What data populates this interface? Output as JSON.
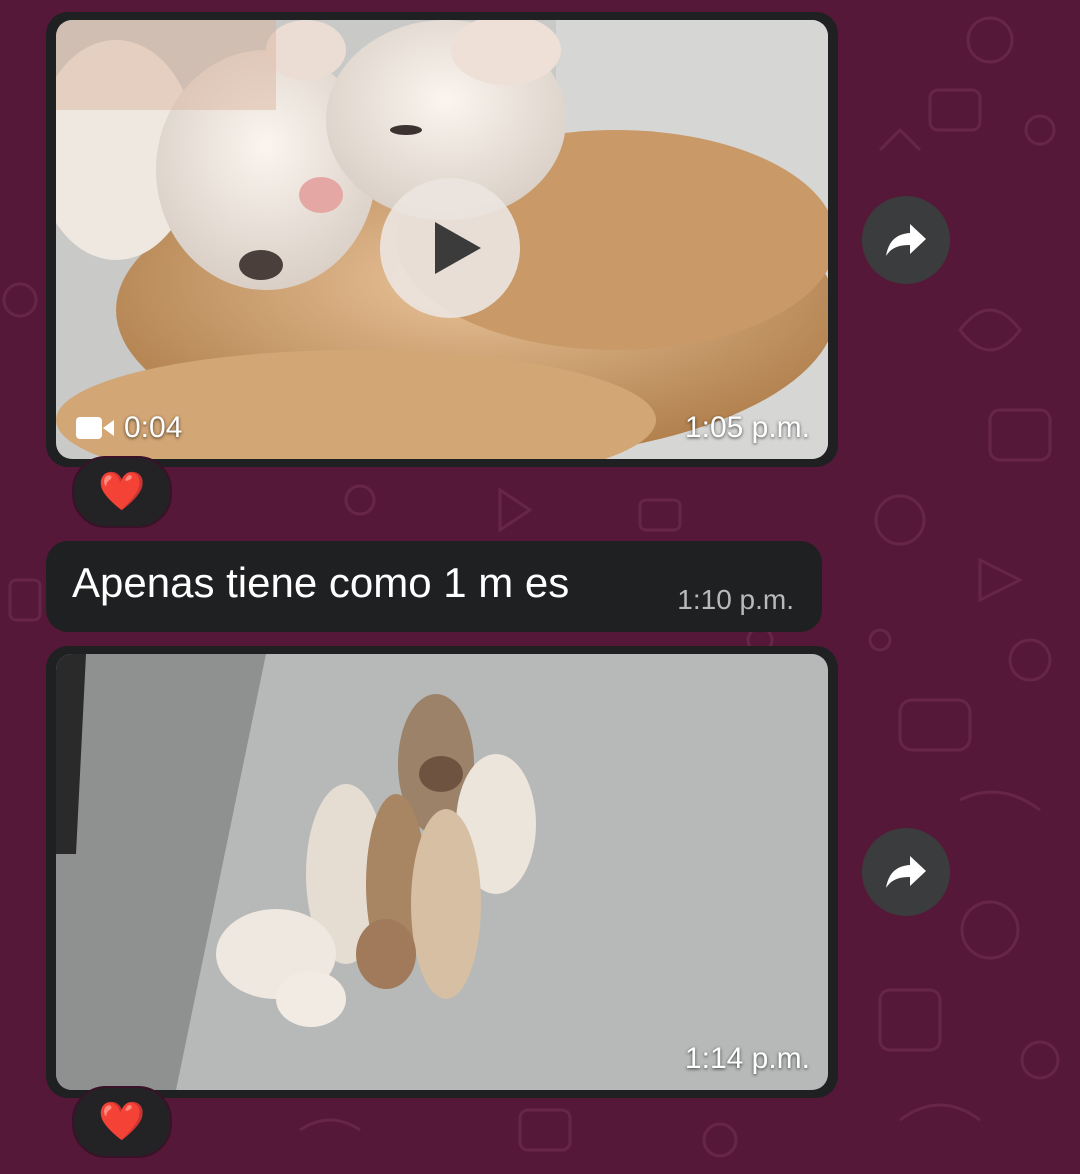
{
  "chat": {
    "messages": [
      {
        "type": "video",
        "duration": "0:04",
        "time": "1:05 p.m.",
        "reaction": "❤️",
        "has_play_button": true
      },
      {
        "type": "text",
        "text": "Apenas tiene como 1 m es",
        "time": "1:10 p.m."
      },
      {
        "type": "image",
        "time": "1:14 p.m.",
        "reaction": "❤️"
      }
    ]
  },
  "icons": {
    "forward": "forward-arrow-icon",
    "video": "video-camera-icon",
    "play": "play-icon"
  },
  "colors": {
    "wallpaper": "#561838",
    "bubble": "#1f2021",
    "forward_button": "#3b3c3e"
  }
}
